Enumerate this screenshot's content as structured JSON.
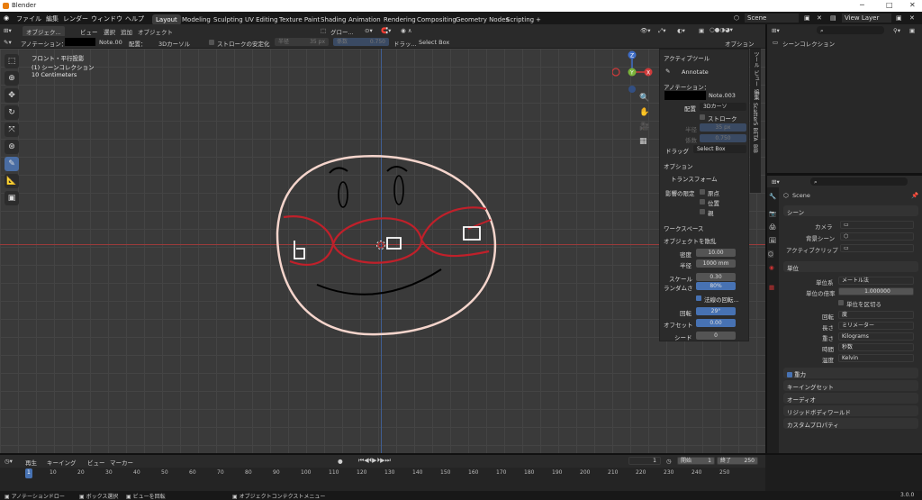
{
  "window": {
    "title": "Blender",
    "minimize": "─",
    "maximize": "□",
    "close": "✕"
  },
  "menu": [
    "ファイル",
    "編集",
    "レンダー",
    "ウィンドウ",
    "ヘルプ"
  ],
  "workspaces": [
    "Layout",
    "Modeling",
    "Sculpting",
    "UV Editing",
    "Texture Paint",
    "Shading",
    "Animation",
    "Rendering",
    "Compositing",
    "Geometry Nodes",
    "Scripting",
    "+"
  ],
  "scene": {
    "name": "Scene",
    "view_layer": "View Layer"
  },
  "viewport_header": {
    "mode": "オブジェク...",
    "menus": [
      "ビュー",
      "選択",
      "追加",
      "オブジェクト"
    ],
    "global": "グロー...",
    "options": "オプション"
  },
  "tool_header": {
    "annotation_label": "アノテーション：",
    "note": "Note.00",
    "placement_label": "配置：",
    "placement": "3Dカーソル",
    "stabilize": "ストロークの安定化",
    "radius_label": "半径",
    "radius": "35 px",
    "factor_label": "係数",
    "factor": "0.750",
    "drag_label": "ドラッ...",
    "drag": "Select Box"
  },
  "overlay_text": {
    "view": "フロント・平行投影",
    "collection": "(1) シーンコレクション",
    "scale": "10 Centimeters"
  },
  "npanel": {
    "active_tool": "アクティブツール",
    "tool_name": "Annotate",
    "annotation": "アノテーション：",
    "note": "Note.003",
    "placement_label": "配置",
    "placement": "3Dカーソ",
    "stroke": "ストロークの...",
    "radius_label": "半径",
    "radius": "35 px",
    "factor_label": "係数",
    "factor": "0.750",
    "drag_label": "ドラッグ",
    "drag": "Select Box",
    "options": "オプション",
    "transform": "トランスフォーム",
    "affect_label": "影響の限定",
    "affect": [
      "原点",
      "位置",
      "親"
    ],
    "workspace": "ワークスペース",
    "scatter_title": "オブジェクトを散乱",
    "scatter": [
      {
        "label": "密度",
        "value": "10.00"
      },
      {
        "label": "半径",
        "value": "1000 mm"
      },
      {
        "label": "スケール",
        "value": "0.30"
      },
      {
        "label": "ランダムさ",
        "value": "80%"
      }
    ],
    "normal": "法線の回転...",
    "rotation_label": "回転",
    "rotation": "29°",
    "offset_label": "オフセット",
    "offset": "0.00",
    "seed_label": "シード",
    "seed": "0"
  },
  "ntabs": [
    "ツール",
    "ビュー",
    "編集",
    "Scatter5 BETA",
    "BlB"
  ],
  "outliner": {
    "root": "シーンコレクション"
  },
  "properties": {
    "scene": "Scene",
    "scene_section": "シーン",
    "camera_label": "カメラ",
    "bg_label": "背景シーン",
    "clip_label": "アクティブクリップ",
    "units": "単位",
    "unit_system_label": "単位系",
    "unit_system": "メートル法",
    "scale_label": "単位の倍率",
    "scale": "1.000000",
    "separate": "単位を区切る",
    "rotation_label": "回転",
    "rotation": "度",
    "length_label": "長さ",
    "length": "ミリメーター",
    "mass_label": "重さ",
    "mass": "Kilograms",
    "time_label": "時間",
    "time": "秒数",
    "temp_label": "温度",
    "temp": "Kelvin",
    "panels": [
      "重力",
      "キーイングセット",
      "オーディオ",
      "リジッドボディワールド",
      "カスタムプロパティ"
    ]
  },
  "timeline": {
    "play": "再生",
    "keying": "キーイング",
    "view": "ビュー",
    "marker": "マーカー",
    "current": "1",
    "start_label": "開始",
    "start": "1",
    "end_label": "終了",
    "end": "250",
    "ticks": [
      "1",
      "10",
      "20",
      "30",
      "40",
      "50",
      "60",
      "70",
      "80",
      "90",
      "100",
      "110",
      "120",
      "130",
      "140",
      "150",
      "160",
      "170",
      "180",
      "190",
      "200",
      "210",
      "220",
      "230",
      "240",
      "250"
    ]
  },
  "status": {
    "left": "アノテーションドロー",
    "mid1": "ボックス選択",
    "mid2": "ビューを回転",
    "ctx": "オブジェクトコンテクストメニュー",
    "version": "3.0.0"
  },
  "gizmo": {
    "z": "Z",
    "y": "Y",
    "x": "X"
  },
  "colors": {
    "accent": "#4772b3",
    "face": "#f5d5cc",
    "mask": "#c0202a"
  }
}
